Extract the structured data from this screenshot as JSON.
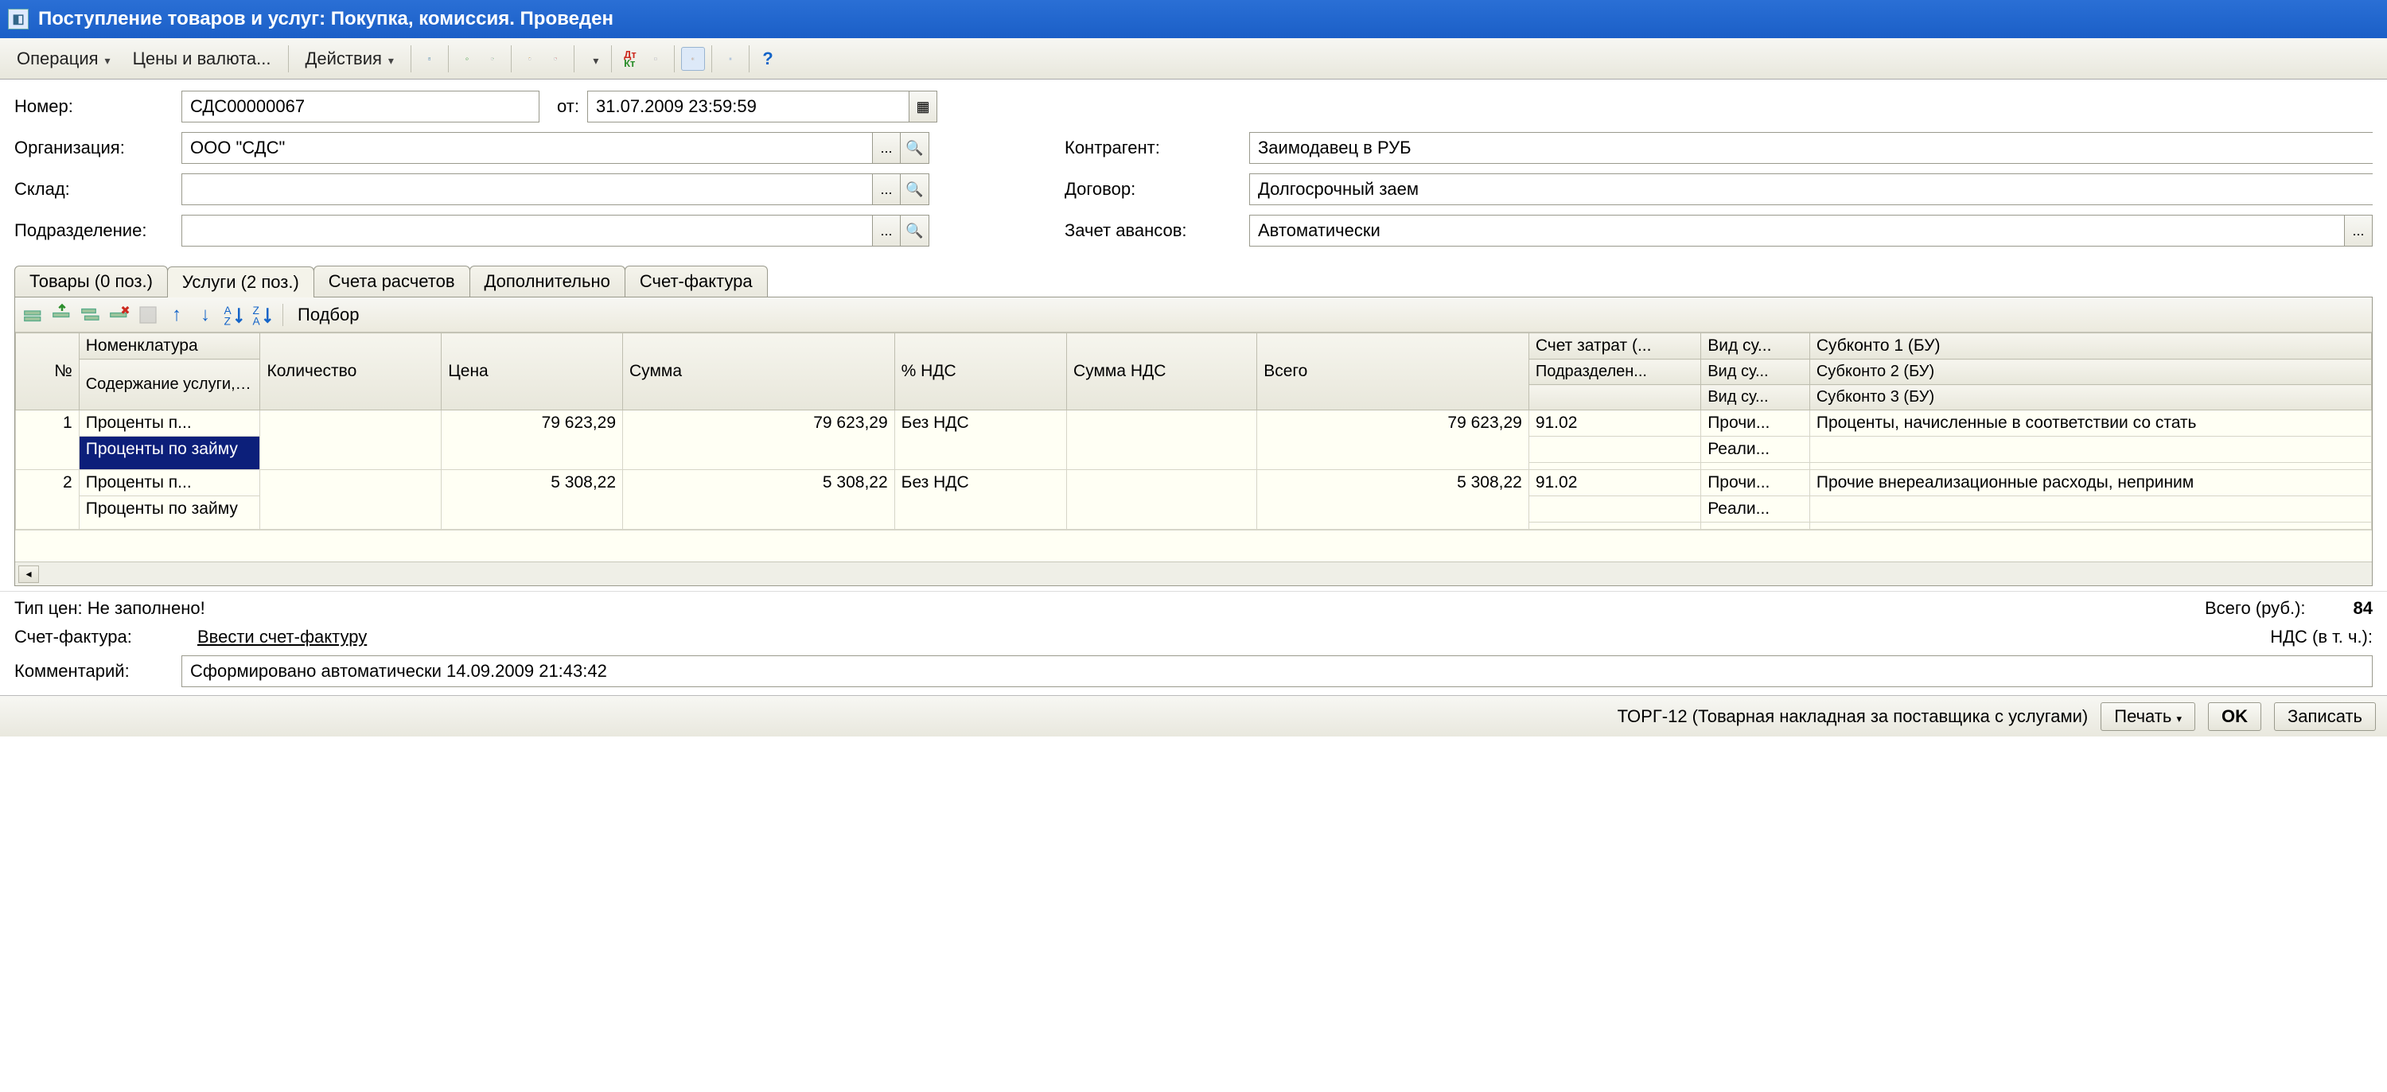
{
  "window": {
    "title": "Поступление товаров и услуг: Покупка, комиссия. Проведен"
  },
  "toolbar": {
    "operation": "Операция",
    "prices": "Цены и валюта...",
    "actions": "Действия"
  },
  "fields": {
    "number_label": "Номер:",
    "number": "СДС00000067",
    "from_label": "от:",
    "date": "31.07.2009 23:59:59",
    "org_label": "Организация:",
    "org": "ООО \"СДС\"",
    "warehouse_label": "Склад:",
    "warehouse": "",
    "division_label": "Подразделение:",
    "division": "",
    "counterparty_label": "Контрагент:",
    "counterparty": "Заимодавец в РУБ",
    "contract_label": "Договор:",
    "contract": "Долгосрочный заем",
    "advance_label": "Зачет авансов:",
    "advance": "Автоматически"
  },
  "tabs": {
    "goods": "Товары (0 поз.)",
    "services": "Услуги (2 поз.)",
    "accounts": "Счета расчетов",
    "extra": "Дополнительно",
    "invoice": "Счет-фактура"
  },
  "tabtoolbar": {
    "selection": "Подбор"
  },
  "grid": {
    "headers": {
      "n": "№",
      "nomen": "Номенклатура",
      "desc": "Содержание услуги, доп.",
      "qty": "Количество",
      "price": "Цена",
      "sum": "Сумма",
      "vatpct": "% НДС",
      "vatsum": "Сумма НДС",
      "total": "Всего",
      "costacct": "Счет затрат (...",
      "subdiv": "Подразделен...",
      "kind1": "Вид су...",
      "kind2": "Вид су...",
      "kind3": "Вид су...",
      "sub1": "Субконто 1 (БУ)",
      "sub2": "Субконто 2 (БУ)",
      "sub3": "Субконто 3 (БУ)"
    },
    "rows": [
      {
        "n": "1",
        "nomen": "Проценты п...",
        "desc": "Проценты по займу",
        "price": "79 623,29",
        "sum": "79 623,29",
        "vatpct": "Без НДС",
        "total": "79 623,29",
        "costacct": "91.02",
        "kind1": "Прочи...",
        "kind2": "Реали...",
        "sub1": "Проценты, начисленные в соответствии со стать"
      },
      {
        "n": "2",
        "nomen": "Проценты п...",
        "desc": "Проценты по займу",
        "price": "5 308,22",
        "sum": "5 308,22",
        "vatpct": "Без НДС",
        "total": "5 308,22",
        "costacct": "91.02",
        "kind1": "Прочи...",
        "kind2": "Реали...",
        "sub1": "Прочие внереализационные расходы, неприним"
      }
    ]
  },
  "footer": {
    "pricetype": "Тип цен: Не заполнено!",
    "invoice_label": "Счет-фактура:",
    "invoice_link": "Ввести счет-фактуру",
    "comment_label": "Комментарий:",
    "comment": "Сформировано автоматически 14.09.2009 21:43:42",
    "total_label": "Всего (руб.):",
    "total_value": "84",
    "vat_label": "НДС (в т. ч.):"
  },
  "status": {
    "form_name": "ТОРГ-12 (Товарная накладная за поставщика с услугами)",
    "print": "Печать",
    "ok": "OK",
    "save": "Записать"
  }
}
